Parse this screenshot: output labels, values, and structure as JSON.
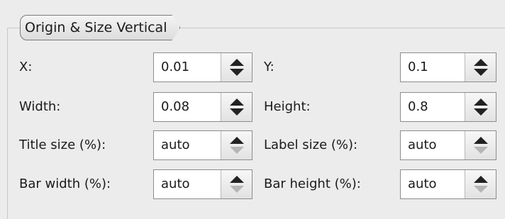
{
  "group": {
    "title": "Origin & Size Vertical"
  },
  "fields": {
    "x": {
      "label": "X:",
      "value": "0.01"
    },
    "y": {
      "label": "Y:",
      "value": "0.1"
    },
    "width": {
      "label": "Width:",
      "value": "0.08"
    },
    "height": {
      "label": "Height:",
      "value": "0.8"
    },
    "title_size": {
      "label": "Title size (%):",
      "value": "auto"
    },
    "label_size": {
      "label": "Label size (%):",
      "value": "auto"
    },
    "bar_width": {
      "label": "Bar width (%):",
      "value": "auto"
    },
    "bar_height": {
      "label": "Bar height (%):",
      "value": "auto"
    }
  },
  "icons": {
    "spin_up": "up-arrow-icon",
    "spin_down": "down-arrow-icon"
  },
  "colors": {
    "background": "#ececec",
    "field_background": "#ffffff",
    "disabled_arrow": "#b5b5b5"
  }
}
